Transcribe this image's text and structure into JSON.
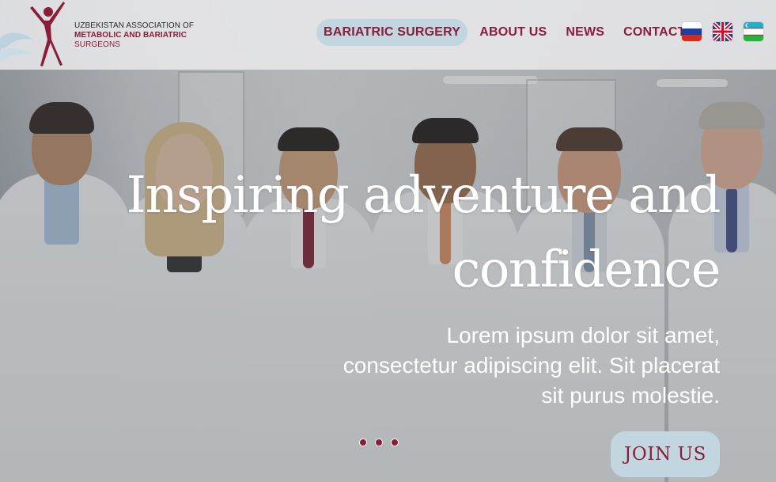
{
  "header": {
    "logo": {
      "line1": "UZBEKISTAN ASSOCIATION OF",
      "line2": "METABOLIC AND BARIATRIC",
      "line3": "SURGEONS",
      "icon": "running-figure-icon"
    },
    "nav": [
      {
        "label": "BARIATRIC SURGERY",
        "active": true
      },
      {
        "label": "ABOUT US",
        "active": false
      },
      {
        "label": "NEWS",
        "active": false
      },
      {
        "label": "CONTACT",
        "active": false
      }
    ],
    "languages": [
      {
        "code": "ru",
        "icon": "russia-flag-icon"
      },
      {
        "code": "en",
        "icon": "uk-flag-icon"
      },
      {
        "code": "uz",
        "icon": "uzbekistan-flag-icon"
      }
    ]
  },
  "hero": {
    "title_line1": "Inspiring adventure and",
    "title_line2": "confidence",
    "subtitle_line1": "Lorem ipsum dolor sit amet,",
    "subtitle_line2": "consectetur adipiscing elit. Sit placerat",
    "subtitle_line3": "sit purus molestie.",
    "slide_count": 3,
    "cta_label": "JOIN US"
  },
  "colors": {
    "brand": "#8a1d3a",
    "accent": "#c1d6df",
    "text_on_hero": "#ffffff"
  }
}
